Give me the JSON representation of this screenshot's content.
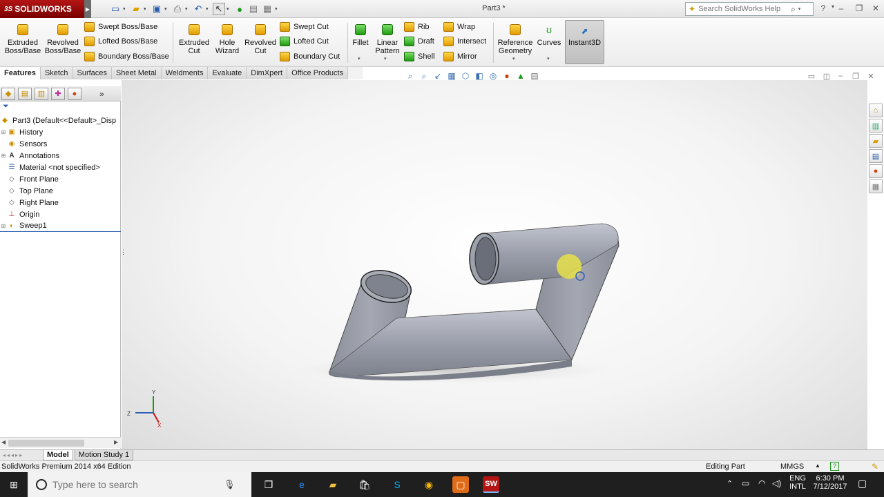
{
  "app": {
    "brand": "SOLIDWORKS",
    "brand_prefix": "3S",
    "document_title": "Part3 *",
    "search_placeholder": "Search SolidWorks Help"
  },
  "toolbar": {
    "big": [
      {
        "label": "Extruded\nBoss/Base"
      },
      {
        "label": "Revolved\nBoss/Base"
      },
      {
        "label": "Extruded\nCut"
      },
      {
        "label": "Hole\nWizard"
      },
      {
        "label": "Revolved\nCut"
      },
      {
        "label": "Fillet"
      },
      {
        "label": "Linear\nPattern"
      },
      {
        "label": "Reference\nGeometry"
      },
      {
        "label": "Curves"
      },
      {
        "label": "Instant3D"
      }
    ],
    "small": [
      {
        "label": "Swept Boss/Base"
      },
      {
        "label": "Lofted Boss/Base"
      },
      {
        "label": "Boundary Boss/Base"
      },
      {
        "label": "Swept Cut"
      },
      {
        "label": "Lofted Cut"
      },
      {
        "label": "Boundary Cut"
      },
      {
        "label": "Rib"
      },
      {
        "label": "Draft"
      },
      {
        "label": "Shell"
      },
      {
        "label": "Wrap"
      },
      {
        "label": "Intersect"
      },
      {
        "label": "Mirror"
      }
    ]
  },
  "tabs": [
    "Features",
    "Sketch",
    "Surfaces",
    "Sheet Metal",
    "Weldments",
    "Evaluate",
    "DimXpert",
    "Office Products"
  ],
  "tree": [
    {
      "label": "Part3  (Default<<Default>_Disp",
      "icon": "part-icon"
    },
    {
      "label": "History",
      "icon": "history-icon"
    },
    {
      "label": "Sensors",
      "icon": "sensors-icon"
    },
    {
      "label": "Annotations",
      "icon": "annotations-icon"
    },
    {
      "label": "Material <not specified>",
      "icon": "material-icon"
    },
    {
      "label": "Front Plane",
      "icon": "plane-icon"
    },
    {
      "label": "Top Plane",
      "icon": "plane-icon"
    },
    {
      "label": "Right Plane",
      "icon": "plane-icon"
    },
    {
      "label": "Origin",
      "icon": "origin-icon"
    },
    {
      "label": "Sweep1",
      "icon": "sweep-icon"
    }
  ],
  "triad": {
    "y": "Y",
    "z": "Z",
    "x": "X"
  },
  "bottom_tabs": [
    "Model",
    "Motion Study 1"
  ],
  "status": {
    "edition": "SolidWorks Premium 2014 x64 Edition",
    "mode": "Editing Part",
    "units": "MMGS"
  },
  "taskbar": {
    "search_placeholder": "Type here to search",
    "lang": "ENG",
    "layout": "INTL",
    "time": "6:30 PM",
    "date": "7/12/2017"
  },
  "colors": {
    "brand_red": "#b31515",
    "part_gray": "#9a9eaa",
    "highlight": "#e6e04a"
  }
}
